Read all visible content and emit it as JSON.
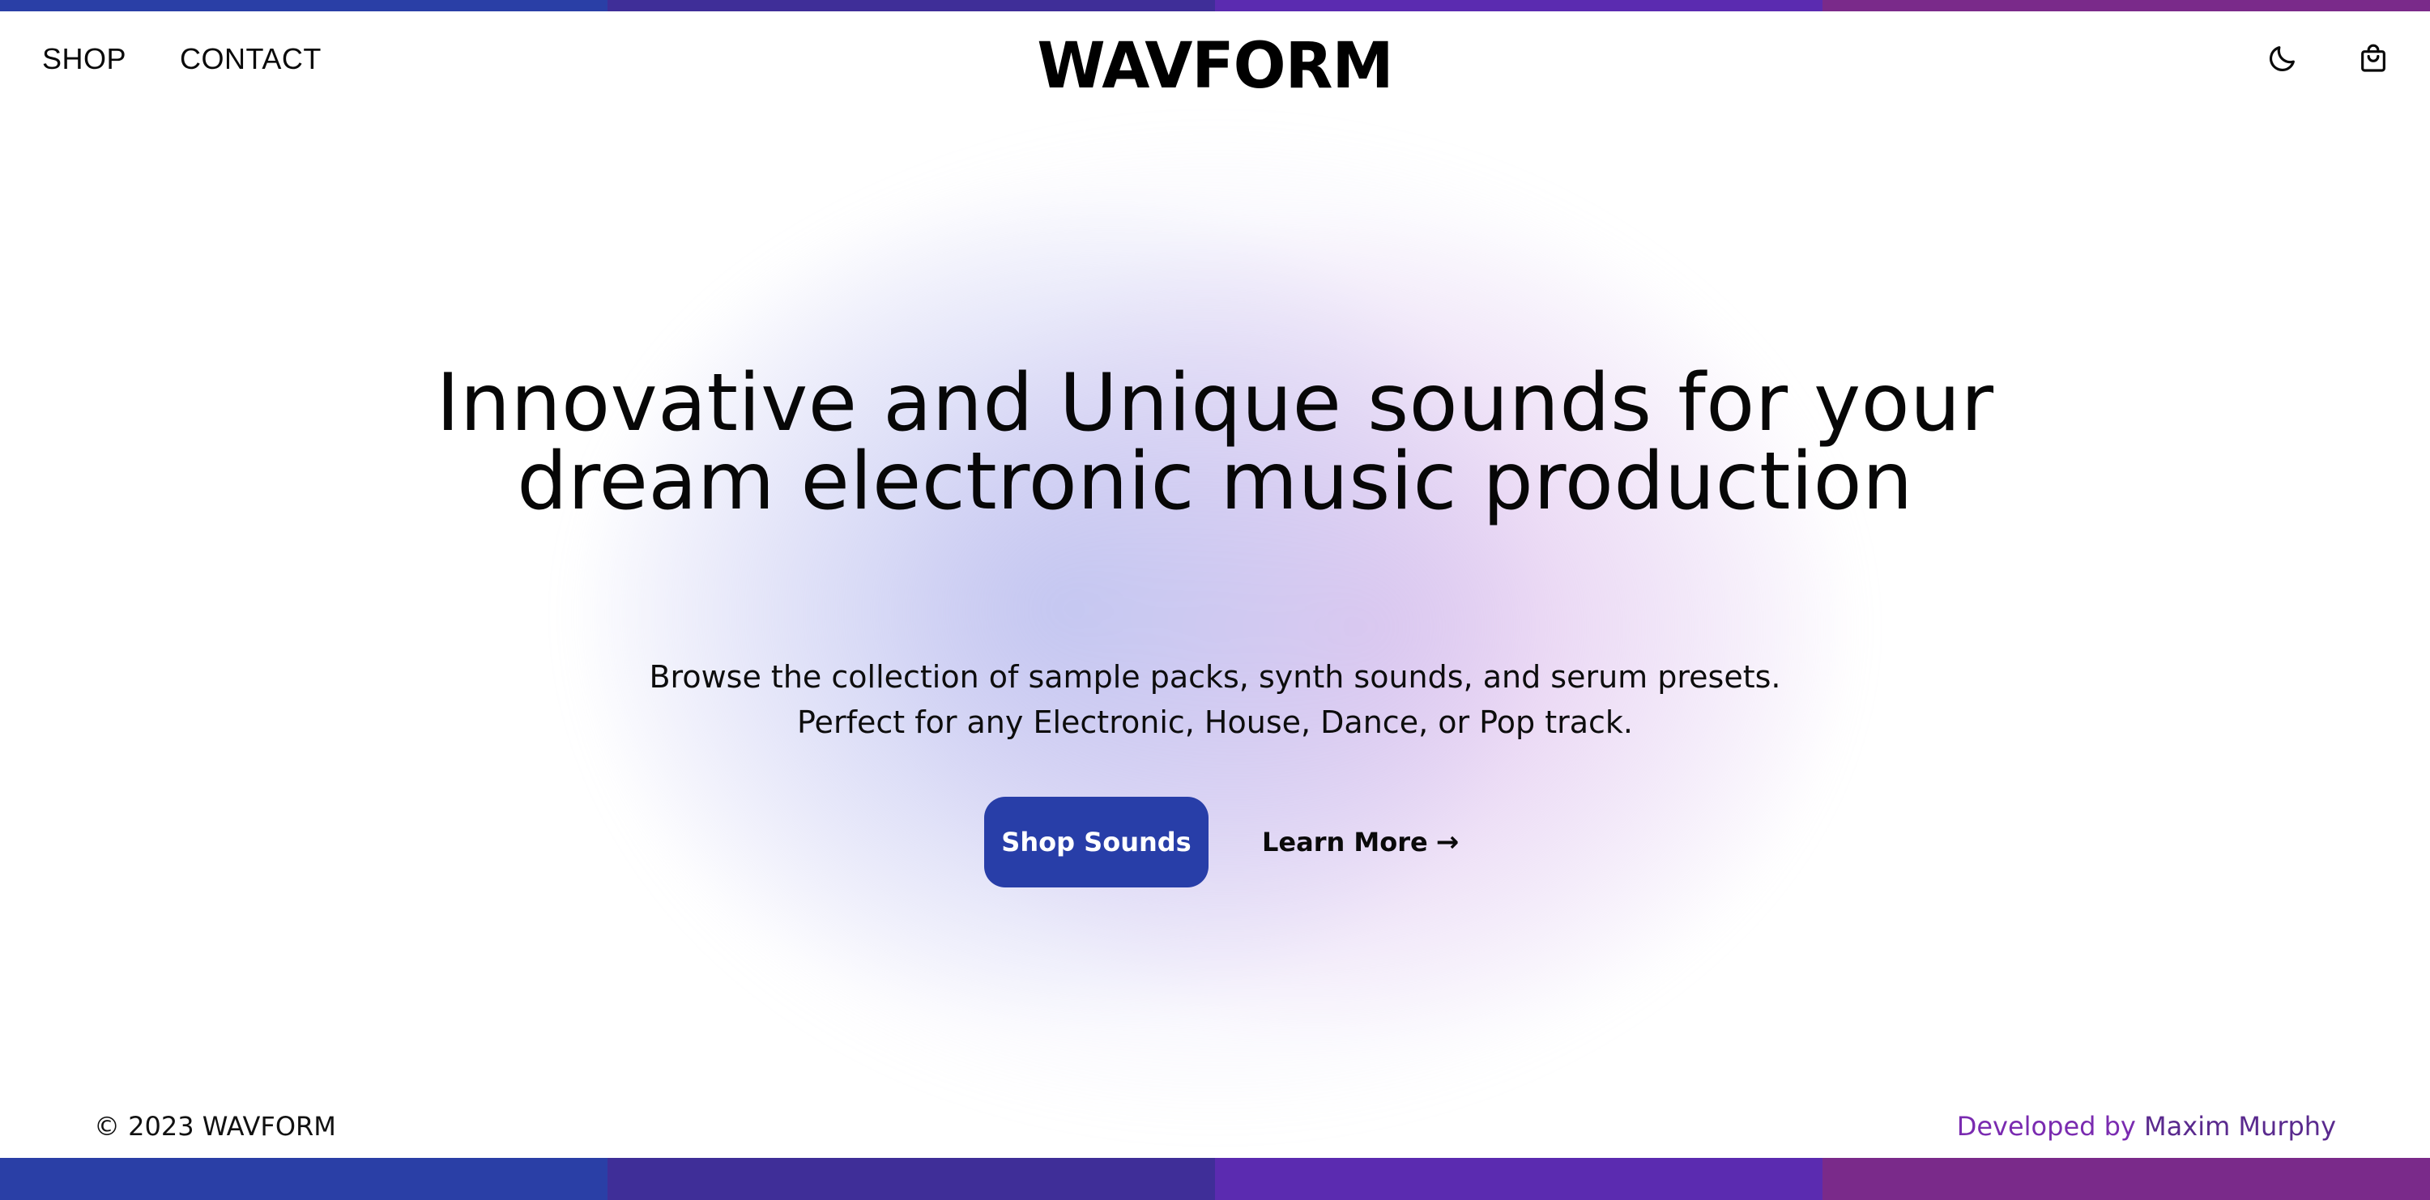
{
  "colors": {
    "stripe_1": "#2a3fa6",
    "stripe_2": "#3f2e98",
    "stripe_3": "#5b2bb0",
    "stripe_4": "#7a2a8a",
    "primary_button": "#283ea8",
    "developer_link": "#7a2bb0"
  },
  "header": {
    "nav": {
      "shop": "SHOP",
      "contact": "CONTACT"
    },
    "logo": "WAVFORM",
    "icons": [
      "moon-icon",
      "shopping-bag-icon"
    ]
  },
  "hero": {
    "title_line1": "Innovative and Unique sounds for your",
    "title_line2": "dream electronic music production",
    "subtitle_line1": "Browse the collection of sample packs, synth sounds, and serum presets.",
    "subtitle_line2": "Perfect for any Electronic, House, Dance, or Pop track.",
    "primary_button": "Shop Sounds",
    "secondary_link": "Learn More",
    "secondary_arrow": "→"
  },
  "footer": {
    "copyright": "© 2023 WAVFORM",
    "credit_prefix": "Developed by",
    "credit_name": "Maxim Murphy"
  }
}
